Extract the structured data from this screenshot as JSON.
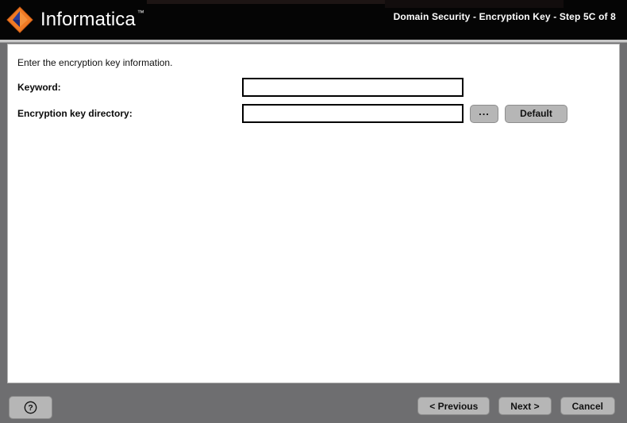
{
  "window": {
    "brand_name": "Informatica",
    "brand_trademark": "™",
    "brand_logo_icon": "informatica-diamond-logo",
    "title": "Domain Security - Encryption Key - Step 5C of 8"
  },
  "content": {
    "instruction": "Enter the encryption key information.",
    "fields": [
      {
        "label": "Keyword:",
        "value": "",
        "placeholder": ""
      },
      {
        "label": "Encryption key directory:",
        "value": "",
        "placeholder": ""
      }
    ],
    "browse_label": "...",
    "default_label": "Default"
  },
  "footer": {
    "help_icon": "question-mark-circle-icon",
    "previous_label": "< Previous",
    "next_label": "Next >",
    "cancel_label": "Cancel"
  },
  "colors": {
    "header_background": "#050505",
    "frame_background": "#6e6e70",
    "panel_background": "#ffffff",
    "button_face": "#b6b6b6",
    "logo_orange": "#f07020",
    "logo_blue": "#2b3f9e"
  }
}
